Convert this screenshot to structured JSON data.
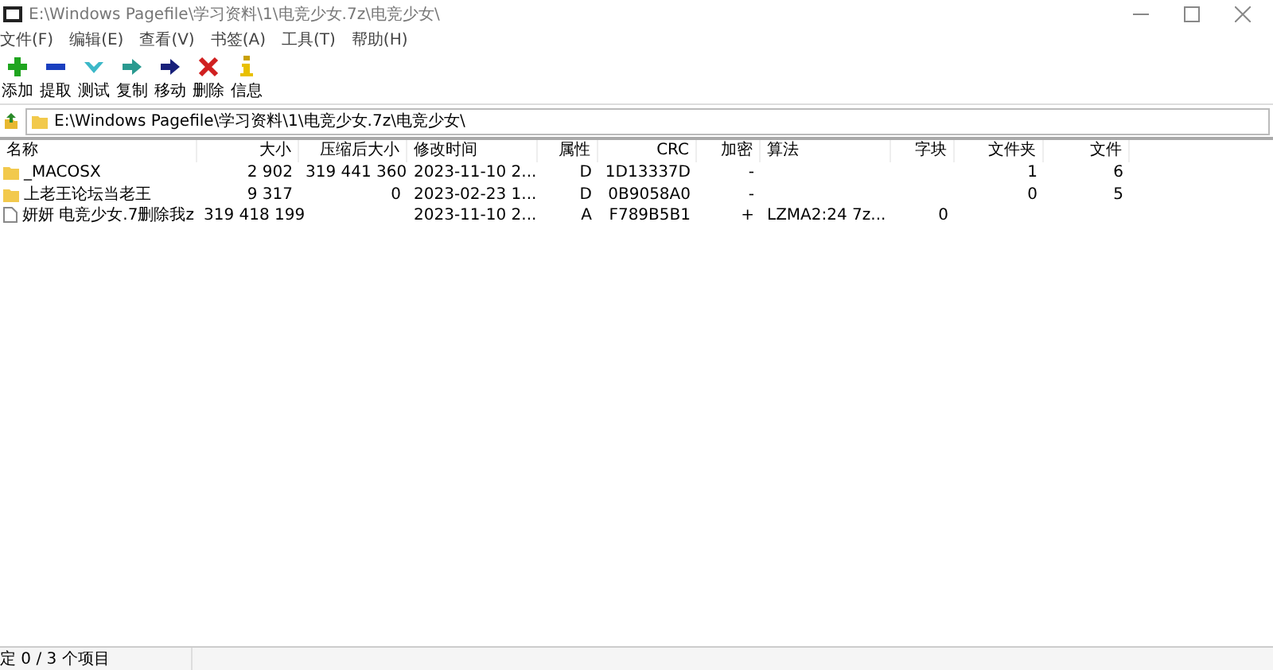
{
  "window": {
    "title": "E:\\Windows Pagefile\\学习资料\\1\\电竞少女.7z\\电竞少女\\"
  },
  "menu": [
    "文件(F)",
    "编辑(E)",
    "查看(V)",
    "书签(A)",
    "工具(T)",
    "帮助(H)"
  ],
  "toolbar": [
    {
      "kind": "add",
      "label": "添加"
    },
    {
      "kind": "extract",
      "label": "提取"
    },
    {
      "kind": "test",
      "label": "测试"
    },
    {
      "kind": "copy",
      "label": "复制"
    },
    {
      "kind": "move",
      "label": "移动"
    },
    {
      "kind": "delete",
      "label": "删除"
    },
    {
      "kind": "info",
      "label": "信息"
    }
  ],
  "address": {
    "value": "E:\\Windows Pagefile\\学习资料\\1\\电竞少女.7z\\电竞少女\\"
  },
  "table": {
    "columns": [
      "名称",
      "大小",
      "压缩后大小",
      "修改时间",
      "属性",
      "CRC",
      "加密",
      "算法",
      "字块",
      "文件夹",
      "文件"
    ],
    "rows": [
      {
        "kind": "folder",
        "cells": [
          "_MACOSX",
          "2 902",
          "319 441 360",
          "2023-11-10 2...",
          "D",
          "1D13337D",
          "-",
          "",
          "",
          "1",
          "6"
        ]
      },
      {
        "kind": "folder",
        "cells": [
          "上老王论坛当老王",
          "9 317",
          "0",
          "2023-02-23 1...",
          "D",
          "0B9058A0",
          "-",
          "",
          "",
          "0",
          "5"
        ]
      },
      {
        "kind": "file",
        "cells": [
          "妍妍 电竞少女.7删除我z",
          "319 418 199",
          "",
          "2023-11-10 2...",
          "A",
          "F789B5B1",
          "+",
          "LZMA2:24 7z...",
          "0",
          "",
          ""
        ]
      }
    ]
  },
  "status_bar": "定 0 / 3 个项目"
}
